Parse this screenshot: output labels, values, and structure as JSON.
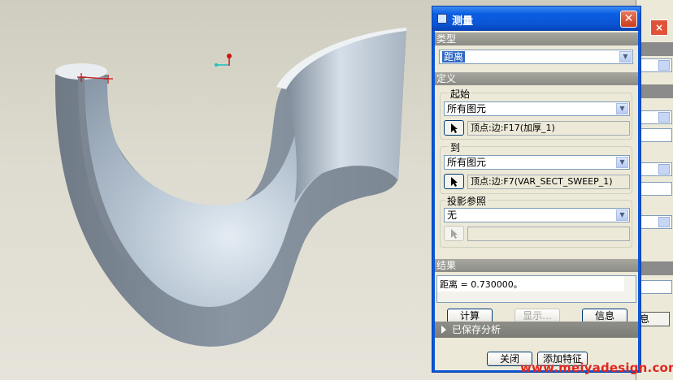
{
  "dialog": {
    "title": "测量",
    "close_icon": "close-icon",
    "type_section": "类型",
    "type_value": "距离",
    "definition_section": "定义",
    "from": {
      "group_label": "起始",
      "filter": "所有图元",
      "reference": "顶点:边:F17(加厚_1)"
    },
    "to": {
      "group_label": "到",
      "filter": "所有图元",
      "reference": "顶点:边:F7(VAR_SECT_SWEEP_1)"
    },
    "projection": {
      "group_label": "投影参照",
      "value": "无",
      "reference": ""
    },
    "result_section": "结果",
    "result_text": "距离 = 0.730000。",
    "buttons": {
      "compute": "计算",
      "display": "显示...",
      "info": "信息"
    },
    "saved_analysis": "已保存分析",
    "footer": {
      "close": "关闭",
      "add_feature": "添加特征"
    }
  },
  "background_panel": {
    "button_fragment": "息"
  },
  "watermark": "www.meiyadesign.com",
  "colors": {
    "titlebar": "#0a58d8",
    "model_surface": "#9aa8b8",
    "watermark": "#e0261f"
  }
}
